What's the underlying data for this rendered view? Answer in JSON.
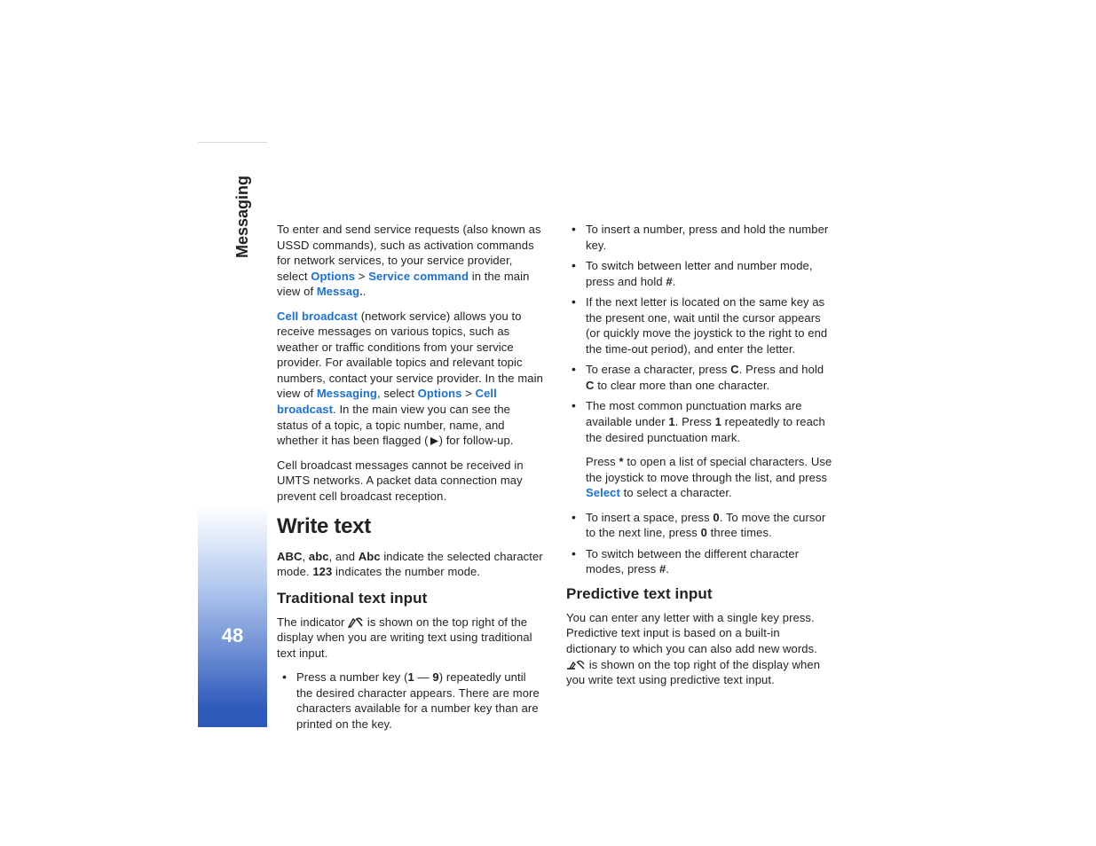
{
  "sidebar": {
    "section": "Messaging",
    "page_number": "48"
  },
  "left": {
    "p1a": "To enter and send service requests (also known as USSD commands), such as activation commands for network services, to your service provider, select ",
    "p1_opt": "Options",
    "p1_gt": " > ",
    "p1_sc": "Service command",
    "p1b": " in the main view of ",
    "p1_msg": "Messag.",
    "p1c": ".",
    "p2_cb": "Cell broadcast",
    "p2a": " (network service) allows you to receive messages on various topics, such as weather or traffic conditions from your service provider. For available topics and relevant topic numbers, contact your service provider. In the main view of ",
    "p2_msg": "Messaging",
    "p2b": ", select ",
    "p2_opt": "Options",
    "p2_gt": " > ",
    "p2_cb2": "Cell broadcast",
    "p2c": ". In the main view you can see the status of a topic, a topic number, name, and whether it has been flagged (",
    "p2d": ") for follow-up.",
    "p3": "Cell broadcast messages cannot be received in UMTS networks. A packet data connection may prevent cell broadcast reception.",
    "h1": "Write text",
    "p4_abc1": "ABC",
    "p4_s1": ", ",
    "p4_abc2": "abc",
    "p4_s2": ", and ",
    "p4_abc3": "Abc",
    "p4a": " indicate the selected character mode. ",
    "p4_123": "123",
    "p4b": " indicates the number mode.",
    "h2": "Traditional text input",
    "p5a": "The indicator ",
    "p5b": " is shown on the top right of the display when you are writing text using traditional text input.",
    "li1a": "Press a number key (",
    "li1_k1": "1",
    "li1_dash": " — ",
    "li1_k9": "9",
    "li1b": ") repeatedly until the desired character appears. There are more characters available for a number key than are printed on the key."
  },
  "right": {
    "li2": "To insert a number, press and hold the number key.",
    "li3a": "To switch between letter and number mode, press and hold ",
    "hash": "#",
    "li3b": ".",
    "li4": "If the next letter is located on the same key as the present one, wait until the cursor appears (or quickly move the joystick to the right to end the time-out period), and enter the letter.",
    "li5a": "To erase a character, press ",
    "c_key": "C",
    "li5b": ". Press and hold ",
    "li5c": " to clear more than one character.",
    "li6a": "The most common punctuation marks are available under ",
    "k1": "1",
    "li6b": ". Press ",
    "li6c": " repeatedly to reach the desired punctuation mark.",
    "li6p2a": "Press ",
    "star": "*",
    "li6p2b": " to open a list of special characters. Use the joystick to move through the list, and press ",
    "select": "Select",
    "li6p2c": " to select a character.",
    "li7a": "To insert a space, press ",
    "k0": "0",
    "li7b": ". To move the cursor to the next line, press ",
    "li7c": " three times.",
    "li8a": "To switch between the different character modes, press ",
    "li8b": ".",
    "h2": "Predictive text input",
    "p1a": "You can enter any letter with a single key press. Predictive text input is based on a built-in dictionary to which you can also add new words. ",
    "p1b": " is shown on the top right of the display when you write text using predictive text input."
  }
}
